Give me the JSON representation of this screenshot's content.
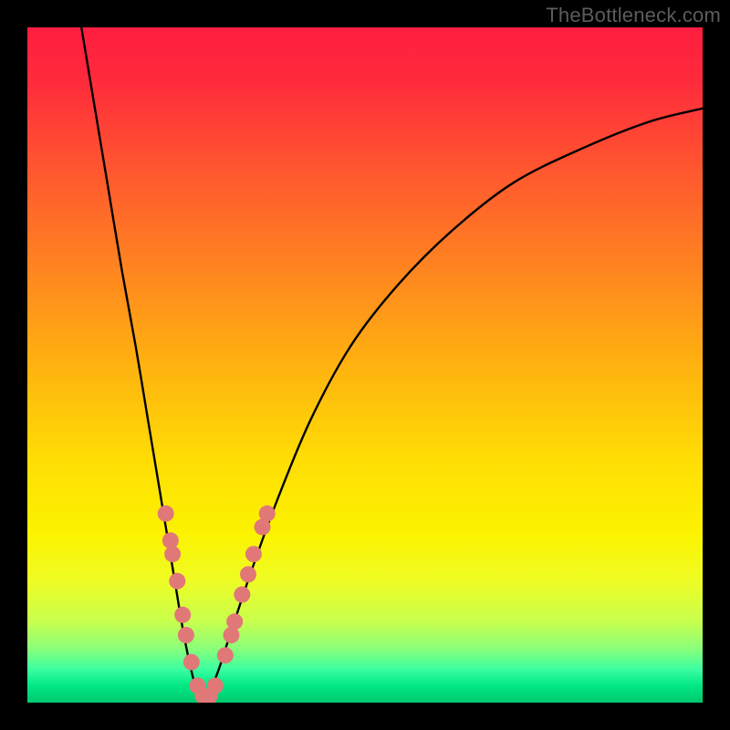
{
  "watermark": "TheBottleneck.com",
  "chart_data": {
    "type": "line",
    "title": "",
    "xlabel": "",
    "ylabel": "",
    "xlim": [
      0,
      100
    ],
    "ylim": [
      0,
      100
    ],
    "gradient_stops": [
      {
        "offset": 0.0,
        "color": "#ff1d3f"
      },
      {
        "offset": 0.08,
        "color": "#ff2b3c"
      },
      {
        "offset": 0.2,
        "color": "#ff5330"
      },
      {
        "offset": 0.35,
        "color": "#ff8221"
      },
      {
        "offset": 0.5,
        "color": "#ffb210"
      },
      {
        "offset": 0.64,
        "color": "#ffdd05"
      },
      {
        "offset": 0.75,
        "color": "#fcf300"
      },
      {
        "offset": 0.82,
        "color": "#eefc24"
      },
      {
        "offset": 0.88,
        "color": "#c8ff4e"
      },
      {
        "offset": 0.92,
        "color": "#8aff7a"
      },
      {
        "offset": 0.95,
        "color": "#3dffa1"
      },
      {
        "offset": 0.975,
        "color": "#00e884"
      },
      {
        "offset": 1.0,
        "color": "#00c96e"
      }
    ],
    "series": [
      {
        "name": "left-branch",
        "x": [
          8,
          10,
          12,
          14,
          16,
          18,
          19,
          20,
          21,
          22,
          23,
          24,
          25,
          26
        ],
        "y": [
          100,
          88,
          76,
          64,
          53,
          41,
          35,
          29,
          23,
          17,
          11,
          6,
          2,
          0
        ]
      },
      {
        "name": "right-branch",
        "x": [
          26,
          28,
          30,
          33,
          37,
          42,
          48,
          55,
          63,
          72,
          82,
          92,
          100
        ],
        "y": [
          0,
          4,
          10,
          19,
          30,
          42,
          53,
          62,
          70,
          77,
          82,
          86,
          88
        ]
      }
    ],
    "markers": {
      "name": "sample-points",
      "color": "#e17878",
      "points": [
        {
          "x": 20.5,
          "y": 28
        },
        {
          "x": 21.2,
          "y": 24
        },
        {
          "x": 21.5,
          "y": 22
        },
        {
          "x": 22.2,
          "y": 18
        },
        {
          "x": 23.0,
          "y": 13
        },
        {
          "x": 23.5,
          "y": 10
        },
        {
          "x": 24.3,
          "y": 6
        },
        {
          "x": 25.2,
          "y": 2.5
        },
        {
          "x": 26.0,
          "y": 1
        },
        {
          "x": 27.0,
          "y": 1
        },
        {
          "x": 27.8,
          "y": 2.5
        },
        {
          "x": 29.3,
          "y": 7
        },
        {
          "x": 30.2,
          "y": 10
        },
        {
          "x": 30.7,
          "y": 12
        },
        {
          "x": 31.8,
          "y": 16
        },
        {
          "x": 32.7,
          "y": 19
        },
        {
          "x": 33.5,
          "y": 22
        },
        {
          "x": 34.8,
          "y": 26
        },
        {
          "x": 35.5,
          "y": 28
        }
      ]
    }
  }
}
